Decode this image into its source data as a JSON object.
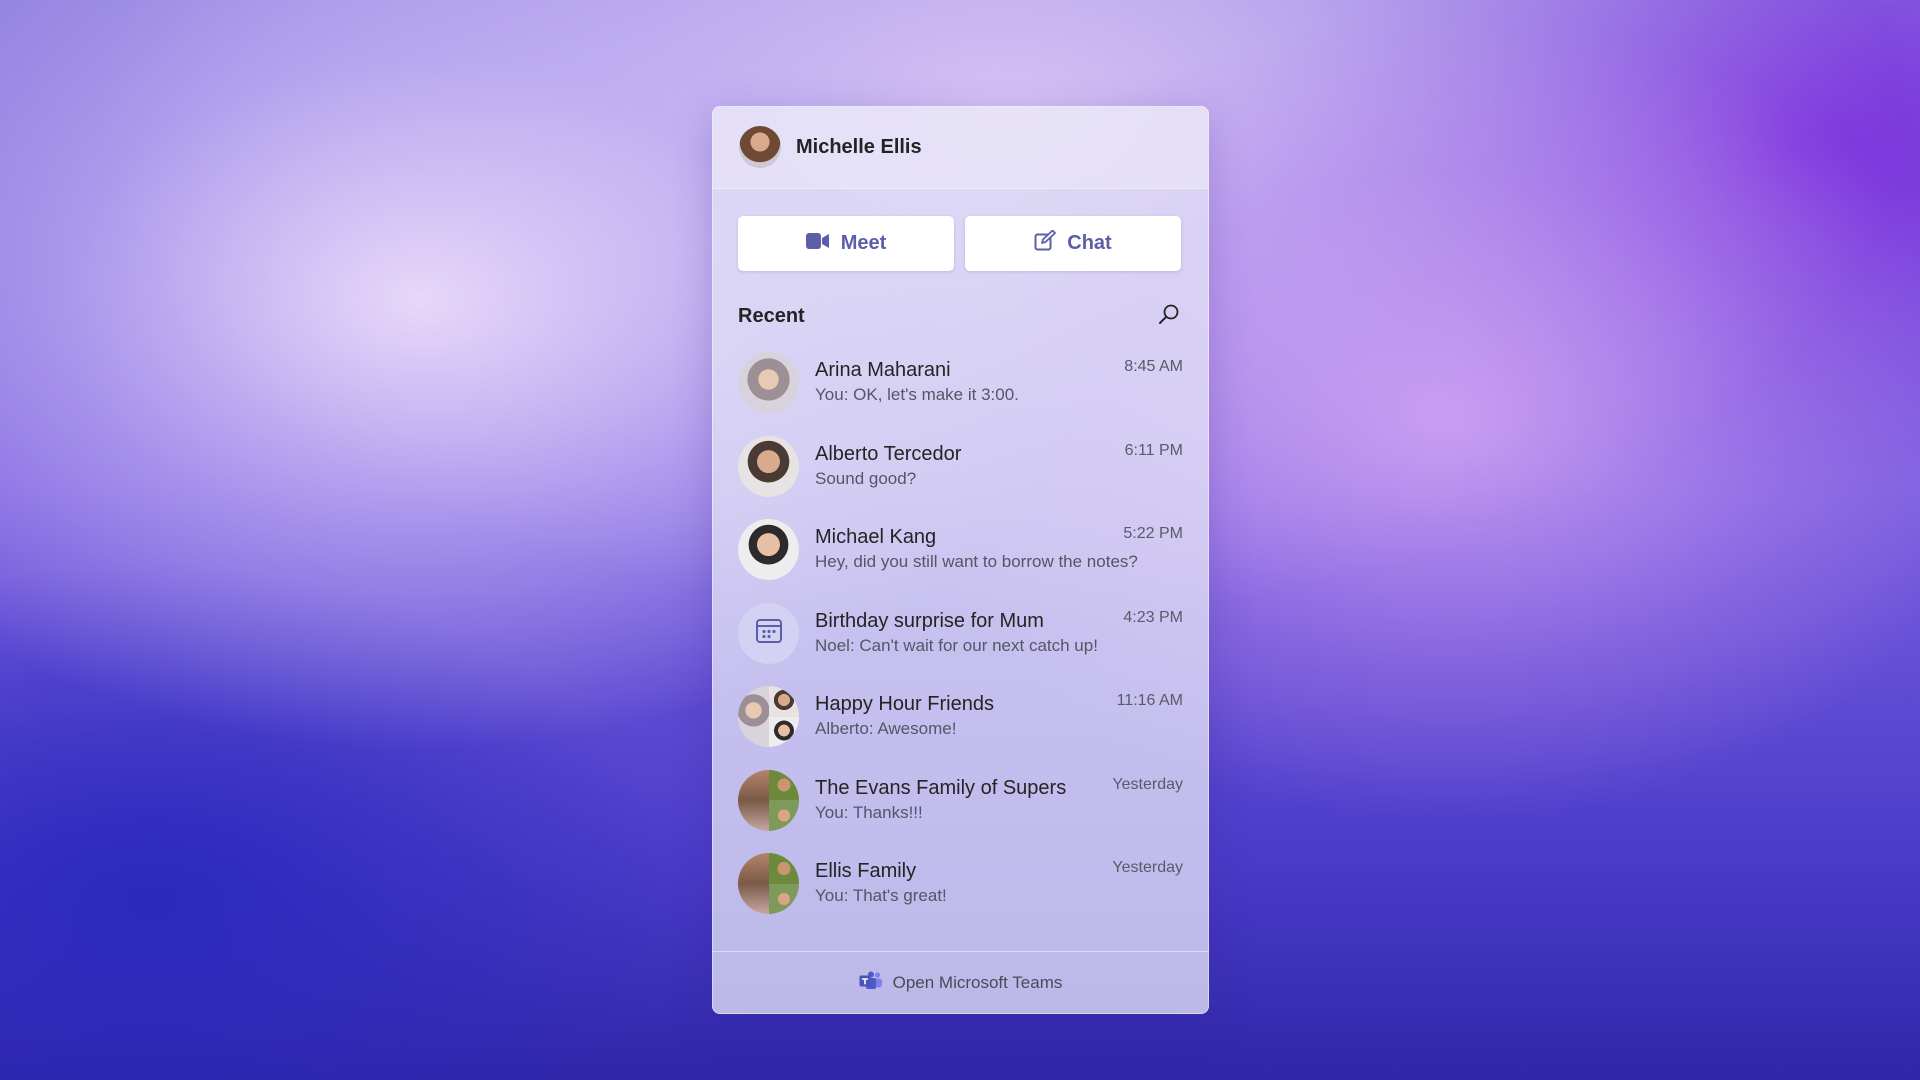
{
  "header": {
    "user_name": "Michelle Ellis"
  },
  "actions": {
    "meet_label": "Meet",
    "chat_label": "Chat"
  },
  "recent": {
    "title": "Recent",
    "items": [
      {
        "name": "Arina Maharani",
        "preview": "You: OK, let's make it 3:00.",
        "time": "8:45 AM"
      },
      {
        "name": "Alberto Tercedor",
        "preview": "Sound good?",
        "time": "6:11 PM"
      },
      {
        "name": "Michael Kang",
        "preview": "Hey, did you still want to borrow the notes?",
        "time": "5:22 PM"
      },
      {
        "name": "Birthday surprise for Mum",
        "preview": "Noel: Can't wait for our next catch up!",
        "time": "4:23 PM"
      },
      {
        "name": "Happy Hour Friends",
        "preview": "Alberto: Awesome!",
        "time": "11:16 AM"
      },
      {
        "name": "The Evans Family of Supers",
        "preview": "You: Thanks!!!",
        "time": "Yesterday"
      },
      {
        "name": "Ellis Family",
        "preview": "You: That's great!",
        "time": "Yesterday"
      }
    ]
  },
  "footer": {
    "label": "Open Microsoft Teams"
  },
  "colors": {
    "accent": "#5b5fa8",
    "panel": "#e2e0f6"
  }
}
